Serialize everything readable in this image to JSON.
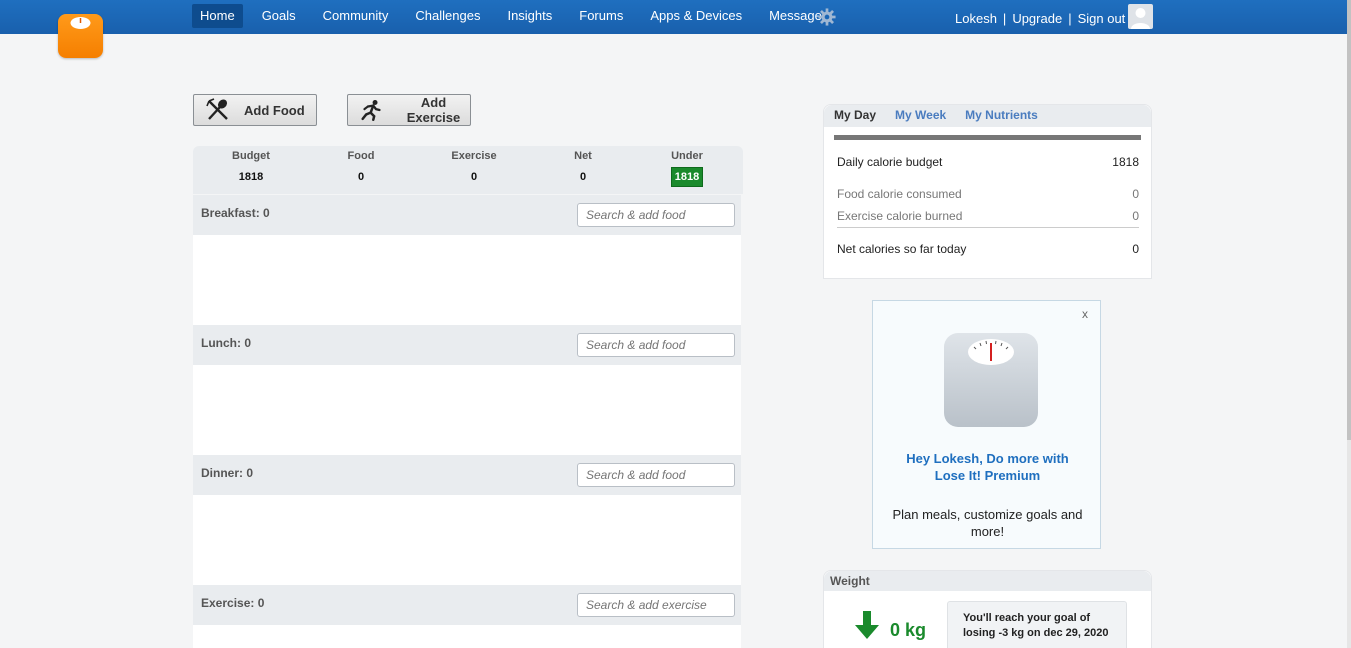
{
  "nav": {
    "items": [
      "Home",
      "Goals",
      "Community",
      "Challenges",
      "Insights",
      "Forums",
      "Apps & Devices",
      "Messages"
    ],
    "active": "Home"
  },
  "user": {
    "name": "Lokesh",
    "upgrade": "Upgrade",
    "signout": "Sign out",
    "sep": "|"
  },
  "actions": {
    "add_food": "Add Food",
    "add_exercise": "Add Exercise"
  },
  "summary": {
    "budget_label": "Budget",
    "budget": "1818",
    "food_label": "Food",
    "food": "0",
    "exercise_label": "Exercise",
    "exercise": "0",
    "net_label": "Net",
    "net": "0",
    "under_label": "Under",
    "under": "1818"
  },
  "meals": {
    "breakfast": {
      "label": "Breakfast: 0",
      "placeholder": "Search & add food"
    },
    "lunch": {
      "label": "Lunch: 0",
      "placeholder": "Search & add food"
    },
    "dinner": {
      "label": "Dinner: 0",
      "placeholder": "Search & add food"
    },
    "exercise": {
      "label": "Exercise: 0",
      "placeholder": "Search & add exercise"
    }
  },
  "day": {
    "tabs": [
      "My Day",
      "My Week",
      "My Nutrients"
    ],
    "budget_label": "Daily calorie budget",
    "budget": "1818",
    "consumed_label": "Food calorie consumed",
    "consumed": "0",
    "burned_label": "Exercise calorie burned",
    "burned": "0",
    "net_label": "Net calories so far today",
    "net": "0"
  },
  "promo": {
    "close": "x",
    "title_line1": "Hey Lokesh, Do more with",
    "title_line2": "Lose It! Premium",
    "desc_line1": "Plan meals, customize goals and",
    "desc_line2": "more!"
  },
  "weight": {
    "title": "Weight",
    "value": "0 kg",
    "goal_line1": "You'll reach your goal of",
    "goal_line2": "losing -3 kg on dec 29, 2020"
  },
  "colors": {
    "nav": "#1f6fbf",
    "accent": "#1a8a2c",
    "logo": "#f57f00"
  }
}
